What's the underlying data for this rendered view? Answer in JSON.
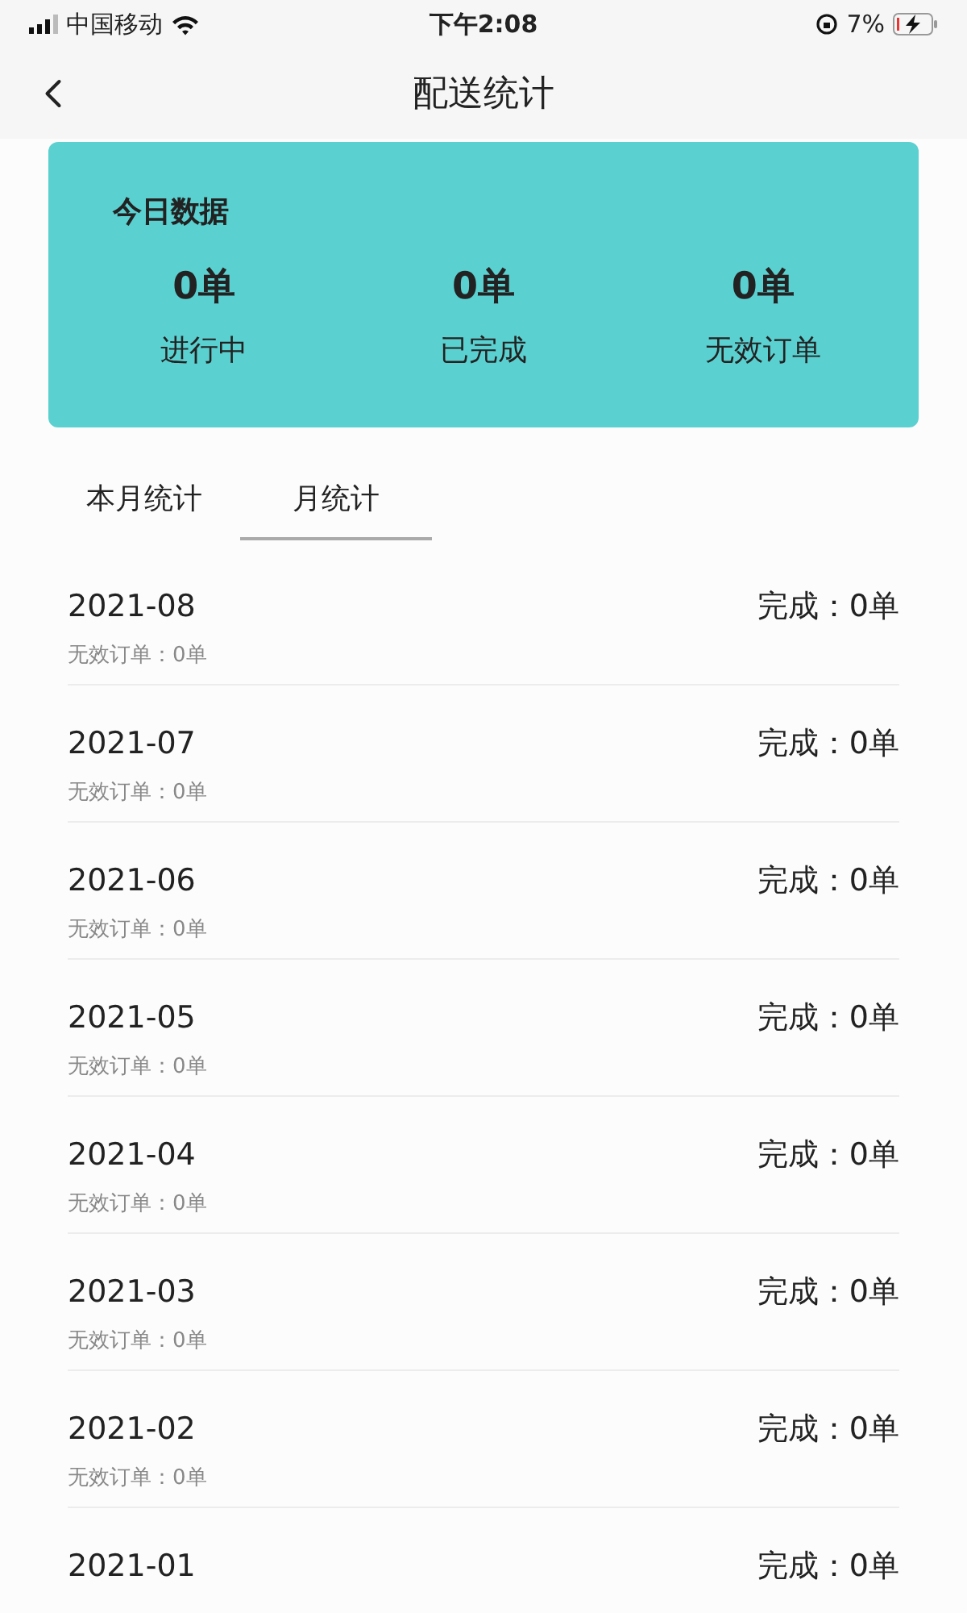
{
  "status_bar": {
    "carrier": "中国移动",
    "time": "下午2:08",
    "battery": "7%"
  },
  "nav": {
    "title": "配送统计"
  },
  "today": {
    "title": "今日数据",
    "stats": [
      {
        "value": "0单",
        "label": "进行中"
      },
      {
        "value": "0单",
        "label": "已完成"
      },
      {
        "value": "0单",
        "label": "无效订单"
      }
    ]
  },
  "tabs": [
    {
      "label": "本月统计",
      "selected": false
    },
    {
      "label": "月统计",
      "selected": true
    }
  ],
  "months": [
    {
      "month": "2021-08",
      "completed": "完成：0单",
      "invalid": "无效订单：0单"
    },
    {
      "month": "2021-07",
      "completed": "完成：0单",
      "invalid": "无效订单：0单"
    },
    {
      "month": "2021-06",
      "completed": "完成：0单",
      "invalid": "无效订单：0单"
    },
    {
      "month": "2021-05",
      "completed": "完成：0单",
      "invalid": "无效订单：0单"
    },
    {
      "month": "2021-04",
      "completed": "完成：0单",
      "invalid": "无效订单：0单"
    },
    {
      "month": "2021-03",
      "completed": "完成：0单",
      "invalid": "无效订单：0单"
    },
    {
      "month": "2021-02",
      "completed": "完成：0单",
      "invalid": "无效订单：0单"
    },
    {
      "month": "2021-01",
      "completed": "完成：0单"
    }
  ]
}
